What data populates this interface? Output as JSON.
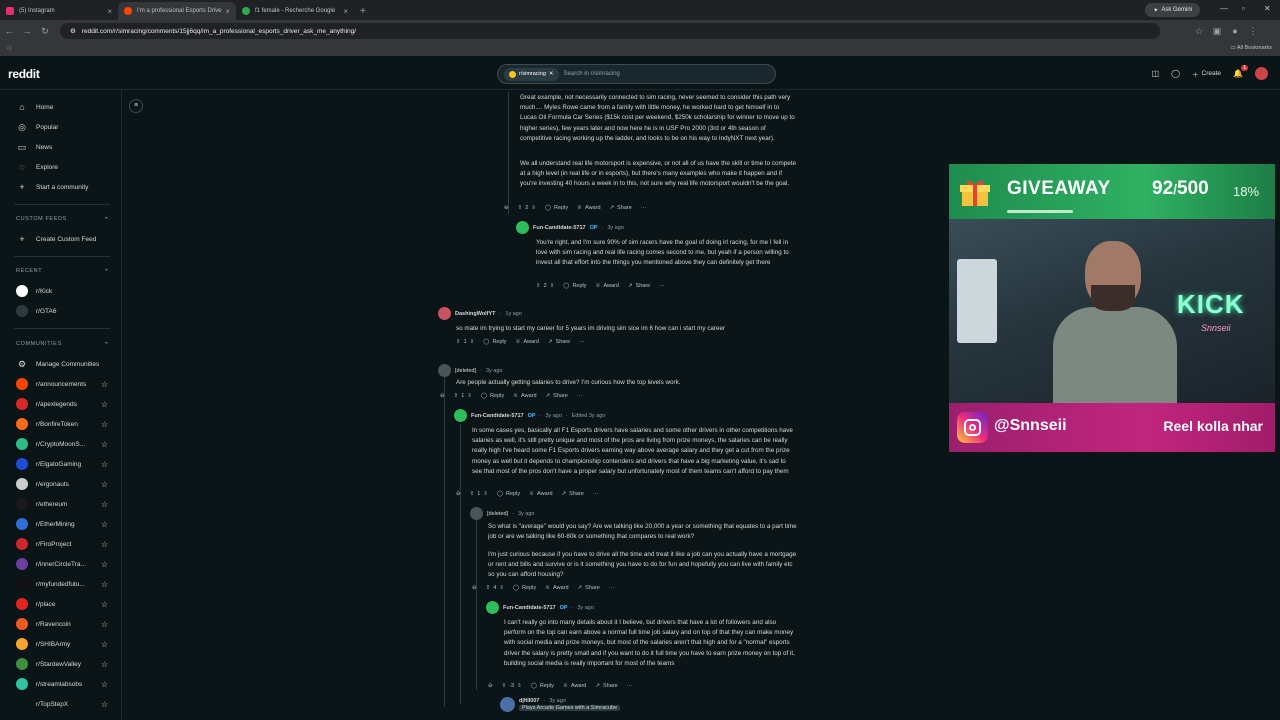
{
  "browser": {
    "tabs": [
      {
        "label": "(5) Instagram",
        "color": "#e1306c"
      },
      {
        "label": "I'm a professional Esports Drive",
        "color": "#ff4500"
      },
      {
        "label": "f1 female - Recherche Google",
        "color": "#34a853"
      }
    ],
    "ask_label": "Ask Gemini",
    "url": "reddit.com/r/simracing/comments/15jj6qq/im_a_professional_esports_driver_ask_me_anything/",
    "all_bookmarks": "All Bookmarks"
  },
  "header": {
    "logo": "reddit",
    "subreddit_chip": "r/simracing",
    "search_placeholder": "Search in r/simracing",
    "create_label": "Create",
    "notif_count": "1"
  },
  "sidebar": {
    "nav": [
      {
        "label": "Home",
        "icon": "home-icon",
        "glyph": "⌂"
      },
      {
        "label": "Popular",
        "icon": "popular-icon",
        "glyph": "◎"
      },
      {
        "label": "News",
        "icon": "news-icon",
        "glyph": "▭"
      },
      {
        "label": "Explore",
        "icon": "explore-icon",
        "glyph": "◌"
      },
      {
        "label": "Start a community",
        "icon": "plus-icon",
        "glyph": "+"
      }
    ],
    "custom_feeds_heading": "CUSTOM FEEDS",
    "create_custom_feed": "Create Custom Feed",
    "recent_heading": "RECENT",
    "recent": [
      {
        "label": "r/Kick",
        "color": "#ffffff"
      },
      {
        "label": "r/GTA6",
        "color": "#2d3a3e"
      }
    ],
    "communities_heading": "COMMUNITIES",
    "manage_communities": "Manage Communities",
    "communities": [
      {
        "label": "r/announcements",
        "color": "#ff4500"
      },
      {
        "label": "r/apexlegends",
        "color": "#da292a"
      },
      {
        "label": "r/BonfireToken",
        "color": "#ff6a1a"
      },
      {
        "label": "r/CryptoMoonS...",
        "color": "#2dbd86"
      },
      {
        "label": "r/ElgatoGaming",
        "color": "#1f4bd8"
      },
      {
        "label": "r/ergonauts",
        "color": "#cccccc"
      },
      {
        "label": "r/ethereum",
        "color": "#1a1a1a"
      },
      {
        "label": "r/EtherMining",
        "color": "#2e6fd8"
      },
      {
        "label": "r/FiroProject",
        "color": "#d0262e"
      },
      {
        "label": "r/innerCircleTra...",
        "color": "#6b3fa0"
      },
      {
        "label": "r/myfundedfutu...",
        "color": "#111111"
      },
      {
        "label": "r/place",
        "color": "#e6261e"
      },
      {
        "label": "r/Ravencoin",
        "color": "#f35a22"
      },
      {
        "label": "r/SHIBArmy",
        "color": "#f7a531"
      },
      {
        "label": "r/StardewValley",
        "color": "#3f8f3c"
      },
      {
        "label": "r/streamlabsobs",
        "color": "#31c3a2"
      },
      {
        "label": "r/TopStepX",
        "color": "#0b1416"
      }
    ]
  },
  "comments": {
    "c0": {
      "p1": "Great example, not necessarily connected to sim racing, never seemed to consider this path very much.... Myles Rowe came from a family with little money, he worked hard to get himself in to Lucas Oil Formula Car Series ($15k cost per weekend, $250k scholarship for winner to move up to higher series), few years later and now here he is in USF Pro 2000 (3rd or 4th season of competitive racing working up the ladder, and looks to be on his way to IndyNXT next year).",
      "p2": "We all understand real life motorsport is expensive, or not all of us have the skill or time to compete at a high level (in real life or in esports), but there's many examples who make it happen and if you're investing 40 hours a week in to this, not sure why real life motorsport wouldn't be the goal.",
      "votes": "2"
    },
    "c1": {
      "author": "Fun-Candidate-5717",
      "op": "OP",
      "time": "3y ago",
      "text": "You're right, and I'm sure 90% of sim racers have the goal of doing irl racing, for me I fell in love with sim racing and real life racing comes second to me, but yeah if a person willing to invest all that effort into the things you mentioned above they can definitely get there",
      "votes": "2"
    },
    "c2": {
      "author": "DashingWolfYT",
      "time": "1y ago",
      "text": "so mate im trying to start my career for 5 years im driving sim sice im 6 how can i start my career",
      "votes": "1"
    },
    "c3": {
      "author": "[deleted]",
      "time": "3y ago",
      "text": "Are people actually getting salaries to drive? I'm curious how the top levels work.",
      "votes": "1"
    },
    "c4": {
      "author": "Fun-Candidate-5717",
      "op": "OP",
      "time": "3y ago",
      "edited": "Edited 3y ago",
      "text": "In some cases yes, basically all F1 Esports drivers have salaries and some other drivers in other competitions have salaries as well, it's still pretty unique and most of the pros are living from prize moneys, the salaries can be really really high I've heard some F1 Esports drivers earning way above average salary and they get a cut from the prize money as well but it depends to championship contenders and drivers that have a big marketing value, it's sad to see that most of the pros don't have a proper salary but unfortunately most of them teams can't afford to pay them",
      "votes": "1"
    },
    "c5": {
      "author": "[deleted]",
      "time": "3y ago",
      "p1": "So what is \"average\" would you say? Are we talking like 20,000 a year or something that equates to a part time job or are we talking like 60-80k or something that compares to real work?",
      "p2": "I'm just curious because if you have to drive all the time and treat it like a job can you actually have a mortgage or rent and bills and survive or is it something you have to do for fun and hopefully you can live with family etc so you can afford housing?",
      "votes": "4"
    },
    "c6": {
      "author": "Fun-Candidate-5717",
      "op": "OP",
      "time": "3y ago",
      "text": "I can't really go into many details about it I believe, but drivers that have a lot of followers and also perform on the top can earn above a normal full time job salary and on top of that they can make money with social media and prize moneys, but most of the salaries aren't that high and for a \"normal\" esports driver the salary is pretty small and if you want to do it full time you have to earn prize money on top of it, building social media is really important for most of the teams",
      "votes": "-3"
    },
    "c7": {
      "author": "djfill007",
      "time": "3y ago",
      "flair": "Plays Arcade Games with a Simracube"
    },
    "actions": {
      "reply": "Reply",
      "award": "Award",
      "share": "Share",
      "more": "···"
    }
  },
  "overlay": {
    "giveaway_title": "GIVEAWAY",
    "count": "92",
    "slash": "/",
    "total": "500",
    "percent": "18%",
    "progress": 0.18,
    "neon_text": "KICK",
    "neon_sub": "Snnseii",
    "ig_handle": "@Snnseii",
    "ig_tagline": "Reel kolla nhar",
    "colors": {
      "giveaway_bg": "#2fb162",
      "instagram_bar": "#c2257e"
    }
  }
}
